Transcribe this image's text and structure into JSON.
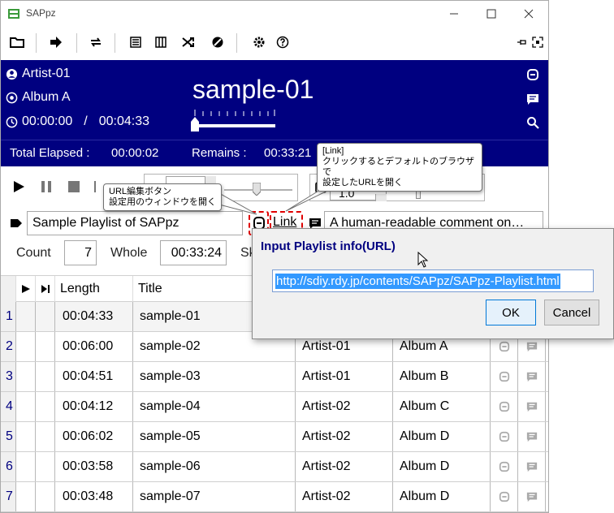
{
  "window": {
    "title": "SAPpz"
  },
  "now_playing": {
    "artist": "Artist-01",
    "album": "Album A",
    "time_current": "00:00:00",
    "time_separator": "/",
    "time_total": "00:04:33",
    "title": "sample-01",
    "seek_fraction": 0.0
  },
  "totals": {
    "elapsed_label": "Total Elapsed :",
    "elapsed_value": "00:00:02",
    "remains_label": "Remains :",
    "remains_value": "00:33:21"
  },
  "controls": {
    "speed_value": "1.0"
  },
  "playlist": {
    "name": "Sample Playlist of SAPpz",
    "link_label": "Link",
    "comment": "A human-readable comment on…"
  },
  "counts": {
    "count_label": "Count",
    "count_value": "7",
    "whole_label": "Whole",
    "whole_value": "00:33:24",
    "sk_label": "Sk"
  },
  "table": {
    "headers": {
      "length": "Length",
      "title": "Title"
    },
    "rows": [
      {
        "num": "1",
        "length": "00:04:33",
        "title": "sample-01",
        "artist": "",
        "album": ""
      },
      {
        "num": "2",
        "length": "00:06:00",
        "title": "sample-02",
        "artist": "Artist-01",
        "album": "Album A"
      },
      {
        "num": "3",
        "length": "00:04:51",
        "title": "sample-03",
        "artist": "Artist-01",
        "album": "Album B"
      },
      {
        "num": "4",
        "length": "00:04:12",
        "title": "sample-04",
        "artist": "Artist-02",
        "album": "Album C"
      },
      {
        "num": "5",
        "length": "00:06:02",
        "title": "sample-05",
        "artist": "Artist-02",
        "album": "Album D"
      },
      {
        "num": "6",
        "length": "00:03:58",
        "title": "sample-06",
        "artist": "Artist-02",
        "album": "Album D"
      },
      {
        "num": "7",
        "length": "00:03:48",
        "title": "sample-07",
        "artist": "Artist-02",
        "album": "Album D"
      }
    ]
  },
  "tooltips": {
    "url_edit_line1": "URL編集ボタン",
    "url_edit_line2": "設定用のウィンドウを開く",
    "link_line1": "[Link]",
    "link_line2": "クリックするとデフォルトのブラウザで",
    "link_line3": "設定したURLを開く"
  },
  "dialog": {
    "title": "Input Playlist info(URL)",
    "url": "http://sdiy.rdy.jp/contents/SAPpz/SAPpz-Playlist.html",
    "ok_label": "OK",
    "cancel_label": "Cancel"
  },
  "colors": {
    "info_bg": "#000080",
    "accent_red": "#e00000",
    "selection": "#3399ff"
  }
}
